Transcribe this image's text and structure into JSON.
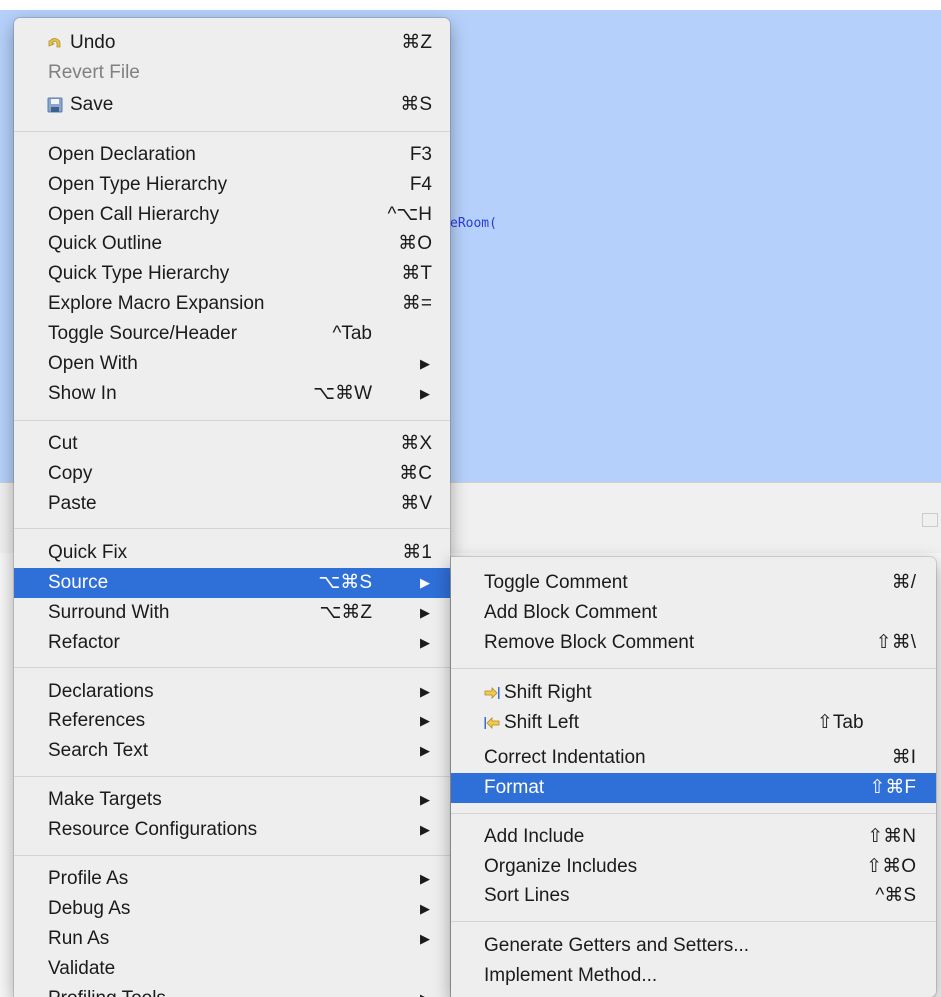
{
  "editor": {
    "code_fragments": [
      "eRoom("
    ]
  },
  "main_menu": {
    "items": [
      {
        "label": "Undo",
        "shortcut": "⌘Z",
        "icon": "undo-icon"
      },
      {
        "label": "Revert File"
      },
      {
        "label": "Save",
        "shortcut": "⌘S",
        "icon": "save-icon"
      },
      {
        "label": "Open Declaration",
        "shortcut": "F3"
      },
      {
        "label": "Open Type Hierarchy",
        "shortcut": "F4"
      },
      {
        "label": "Open Call Hierarchy",
        "shortcut": "^⌥H"
      },
      {
        "label": "Quick Outline",
        "shortcut": "⌘O"
      },
      {
        "label": "Quick Type Hierarchy",
        "shortcut": "⌘T"
      },
      {
        "label": "Explore Macro Expansion",
        "shortcut": "⌘="
      },
      {
        "label": "Toggle Source/Header",
        "shortcut": "^Tab"
      },
      {
        "label": "Open With",
        "arrow": "▶"
      },
      {
        "label": "Show In",
        "shortcut": "⌥⌘W",
        "arrow": "▶"
      },
      {
        "label": "Cut",
        "shortcut": "⌘X"
      },
      {
        "label": "Copy",
        "shortcut": "⌘C"
      },
      {
        "label": "Paste",
        "shortcut": "⌘V"
      },
      {
        "label": "Quick Fix",
        "shortcut": "⌘1"
      },
      {
        "label": "Source",
        "shortcut": "⌥⌘S",
        "arrow": "▶"
      },
      {
        "label": "Surround With",
        "shortcut": "⌥⌘Z",
        "arrow": "▶"
      },
      {
        "label": "Refactor",
        "arrow": "▶"
      },
      {
        "label": "Declarations",
        "arrow": "▶"
      },
      {
        "label": "References",
        "arrow": "▶"
      },
      {
        "label": "Search Text",
        "arrow": "▶"
      },
      {
        "label": "Make Targets",
        "arrow": "▶"
      },
      {
        "label": "Resource Configurations",
        "arrow": "▶"
      },
      {
        "label": "Profile As",
        "arrow": "▶"
      },
      {
        "label": "Debug As",
        "arrow": "▶"
      },
      {
        "label": "Run As",
        "arrow": "▶"
      },
      {
        "label": "Validate"
      },
      {
        "label": "Profiling Tools",
        "arrow": "▶"
      }
    ]
  },
  "source_submenu": {
    "items": [
      {
        "label": "Toggle Comment",
        "shortcut": "⌘/"
      },
      {
        "label": "Add Block Comment"
      },
      {
        "label": "Remove Block Comment",
        "shortcut": "⇧⌘\\"
      },
      {
        "label": "Shift Right",
        "icon": "shift-right-icon"
      },
      {
        "label": "Shift Left",
        "shortcut": "⇧Tab",
        "icon": "shift-left-icon"
      },
      {
        "label": "Correct Indentation",
        "shortcut": "⌘I"
      },
      {
        "label": "Format",
        "shortcut": "⇧⌘F"
      },
      {
        "label": "Add Include",
        "shortcut": "⇧⌘N"
      },
      {
        "label": "Organize Includes",
        "shortcut": "⇧⌘O"
      },
      {
        "label": "Sort Lines",
        "shortcut": "^⌘S"
      },
      {
        "label": "Generate Getters and Setters..."
      },
      {
        "label": "Implement Method..."
      }
    ]
  },
  "colors": {
    "editor_selection": "#b5d1fb",
    "menu_background": "#eeeeee",
    "highlight": "#2f6fd8"
  }
}
